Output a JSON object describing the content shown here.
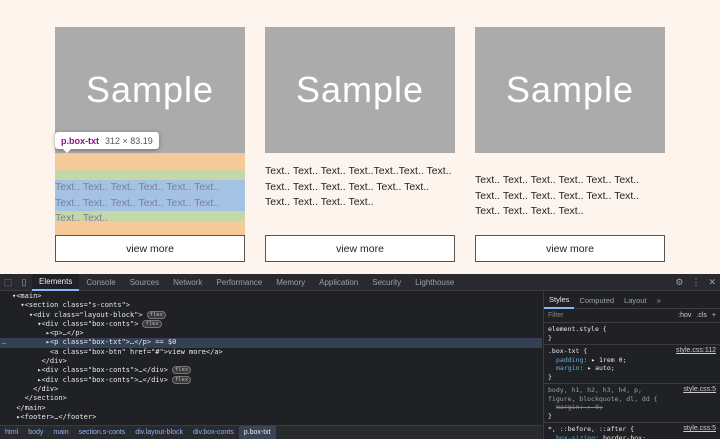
{
  "cards": [
    {
      "image_label": "Sample",
      "text": "Text.. Text.. Text.. Text.. Text.. Text.. Text.. Text.. Text.. Text.. Text.. Text.. Text.. Text..",
      "button": "view more"
    },
    {
      "image_label": "Sample",
      "text": "Text.. Text.. Text.. Text..Text..Text.. Text.. Text.. Text.. Text.. Text.. Text.. Text.. Text.. Text.. Text.. Text..",
      "button": "view more"
    },
    {
      "image_label": "Sample",
      "text": "Text.. Text.. Text.. Text.. Text.. Text.. Text.. Text.. Text.. Text.. Text.. Text.. Text.. Text.. Text.. Text..",
      "button": "view more"
    }
  ],
  "highlight_tooltip": {
    "name": "p.box-txt",
    "size": "312 × 83.19"
  },
  "devtools": {
    "tabs": [
      "Elements",
      "Console",
      "Sources",
      "Network",
      "Performance",
      "Memory",
      "Application",
      "Security",
      "Lighthouse"
    ],
    "dom_lines": [
      {
        "text": "▾<main>"
      },
      {
        "text": "  ▾<section class=\"s-conts\">"
      },
      {
        "text": "    ▾<div class=\"layout-block\">",
        "badge": "flex"
      },
      {
        "text": "      ▾<div class=\"box-conts\">",
        "badge": "flex"
      },
      {
        "text": "        ▸<p>…</p>"
      },
      {
        "text": "        ▸<p class=\"box-txt\">…</p> == $0",
        "selected": true
      },
      {
        "text": "         <a class=\"box-btn\" href=\"#\">view more</a>"
      },
      {
        "text": "       </div>"
      },
      {
        "text": "      ▸<div class=\"box-conts\">…</div>",
        "badge": "flex"
      },
      {
        "text": "      ▸<div class=\"box-conts\">…</div>",
        "badge": "flex"
      },
      {
        "text": "     </div>"
      },
      {
        "text": "   </section>"
      },
      {
        "text": " </main>"
      },
      {
        "text": " ▸<footer>…</footer>"
      }
    ],
    "breadcrumbs": [
      "html",
      "body",
      "main",
      "section.s-conts",
      "div.layout-block",
      "div.box-conts",
      "p.box-txt"
    ],
    "styles_tabs": [
      "Styles",
      "Computed",
      "Layout",
      "»"
    ],
    "filter_placeholder": "Filter",
    "filter_opts": [
      ":hov",
      ".cls",
      "+"
    ],
    "rules": [
      {
        "selector": "element.style {",
        "source": "",
        "props": [],
        "close": "}"
      },
      {
        "selector": ".box-txt {",
        "source": "style.css:112",
        "props": [
          {
            "name": "padding",
            "value": "▸ 1rem 0;"
          },
          {
            "name": "margin",
            "value": "▸ auto;"
          }
        ],
        "close": "}"
      },
      {
        "selector": "body, h1, h2, h3, h4, p, figure, blockquote, dl, dd {",
        "source": "style.css:5",
        "props": [
          {
            "name": "margin",
            "value": "▸ 0;",
            "strike": true
          }
        ],
        "close": "}"
      },
      {
        "selector": "*, ::before, ::after {",
        "source": "style.css:5",
        "props": [
          {
            "name": "box-sizing",
            "value": "border-box;"
          }
        ],
        "close": ""
      }
    ]
  }
}
